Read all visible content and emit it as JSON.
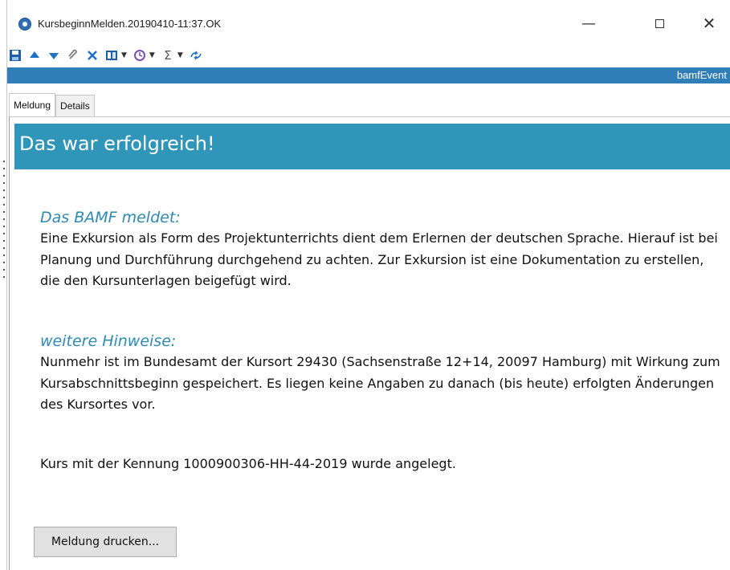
{
  "window": {
    "title": "KursbeginnMelden.20190410-11:37.OK",
    "minimize_glyph": "—",
    "close_glyph": "✕"
  },
  "toolbar": {
    "icons": [
      "save-icon",
      "arrow-up-icon",
      "arrow-down-icon",
      "attach-icon",
      "delete-icon",
      "columns-icon",
      "clock-icon",
      "sum-icon",
      "refresh-icon"
    ]
  },
  "strip": {
    "label": "bamfEvent"
  },
  "tabs": [
    {
      "label": "Meldung",
      "active": true
    },
    {
      "label": "Details",
      "active": false
    }
  ],
  "header": {
    "title": "Das war erfolgreich!"
  },
  "sections": [
    {
      "title": "Das BAMF meldet:",
      "text": "Eine Exkursion als Form des Projektunterrichts dient dem Erlernen der deutschen Sprache. Hierauf ist bei Planung und Durchführung durchgehend zu achten. Zur Exkursion ist eine Dokumentation zu erstellen, die den Kursunterlagen beigefügt wird."
    },
    {
      "title": "weitere Hinweise:",
      "text": "Nunmehr ist im Bundesamt der Kursort 29430 (Sachsenstraße 12+14, 20097 Hamburg) mit Wirkung zum Kursabschnittsbeginn gespeichert. Es liegen keine Angaben zu danach (bis heute) erfolgten Änderungen des Kursortes vor."
    },
    {
      "text": "Kurs mit der Kennung 1000900306-HH-44-2019 wurde angelegt."
    }
  ],
  "buttons": {
    "print": "Meldung drucken..."
  },
  "colors": {
    "accent": "#2f95b9",
    "strip": "#2f7eb8",
    "section_title": "#2e8ab3"
  }
}
